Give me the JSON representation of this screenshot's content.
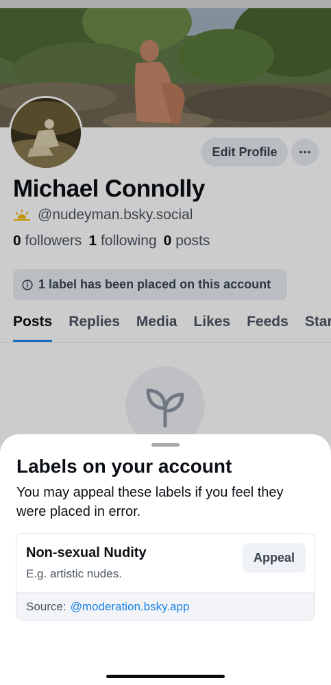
{
  "profile": {
    "edit_label": "Edit Profile",
    "more_label": "···",
    "display_name": "Michael Connolly",
    "handle_emoji": "sunrise-emoji",
    "handle": "@nudeyman.bsky.social",
    "stats": {
      "followers_count": "0",
      "followers_label": "followers",
      "following_count": "1",
      "following_label": "following",
      "posts_count": "0",
      "posts_label": "posts"
    },
    "label_notice": "1 label has been placed on this account"
  },
  "tabs": [
    {
      "label": "Posts",
      "active": true
    },
    {
      "label": "Replies"
    },
    {
      "label": "Media"
    },
    {
      "label": "Likes"
    },
    {
      "label": "Feeds"
    },
    {
      "label": "Starter Packs"
    }
  ],
  "empty_state": {
    "icon": "sprout-icon"
  },
  "sheet": {
    "title": "Labels on your account",
    "description": "You may appeal these labels if you feel they were placed in error.",
    "label": {
      "name": "Non-sexual Nudity",
      "description": "E.g. artistic nudes.",
      "appeal_label": "Appeal",
      "source_label": "Source:",
      "source_link": "@moderation.bsky.app"
    }
  },
  "colors": {
    "accent": "#1d83e6",
    "text_primary": "#0b0f14",
    "text_secondary": "#4c5663",
    "button_bg": "#e8ecf1"
  }
}
